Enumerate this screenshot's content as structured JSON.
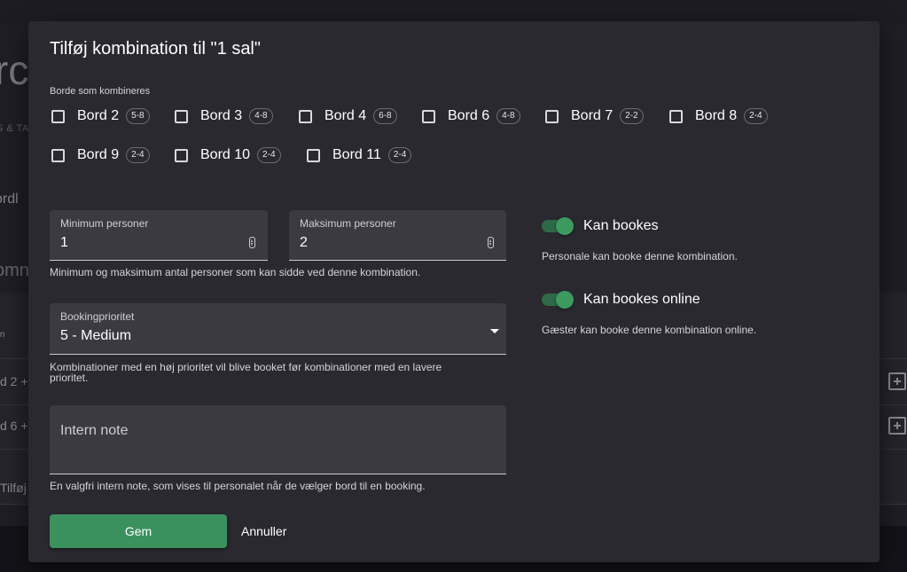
{
  "background": {
    "heading": "rc",
    "subheading": "S & TA",
    "label1": "ordl",
    "label2": "omn",
    "table_header": "n",
    "rows": [
      "d 2 +",
      "d 6 +",
      "Tilføj"
    ]
  },
  "dialog": {
    "title": "Tilføj kombination til \"1 sal\"",
    "tables_label": "Borde som kombineres",
    "tables": [
      {
        "name": "Bord 2",
        "capacity": "5-8",
        "checked": false
      },
      {
        "name": "Bord 3",
        "capacity": "4-8",
        "checked": false
      },
      {
        "name": "Bord 4",
        "capacity": "6-8",
        "checked": false
      },
      {
        "name": "Bord 6",
        "capacity": "4-8",
        "checked": false
      },
      {
        "name": "Bord 7",
        "capacity": "2-2",
        "checked": false
      },
      {
        "name": "Bord 8",
        "capacity": "2-4",
        "checked": false
      },
      {
        "name": "Bord 9",
        "capacity": "2-4",
        "checked": false
      },
      {
        "name": "Bord 10",
        "capacity": "2-4",
        "checked": false
      },
      {
        "name": "Bord 11",
        "capacity": "2-4",
        "checked": false
      }
    ],
    "min_persons": {
      "label": "Minimum personer",
      "value": "1"
    },
    "max_persons": {
      "label": "Maksimum personer",
      "value": "2"
    },
    "persons_helper": "Minimum og maksimum antal personer som kan sidde ved denne kombination.",
    "priority": {
      "label": "Bookingprioritet",
      "value": "5 - Medium"
    },
    "priority_helper_line1": "Kombinationer med en høj prioritet vil blive booket før kombinationer med en lavere",
    "priority_helper_line2": "prioritet.",
    "note": {
      "placeholder": "Intern note",
      "value": ""
    },
    "note_helper": "En valgfri intern note, som vises til personalet når de vælger bord til en booking.",
    "toggle_bookable": {
      "label": "Kan bookes",
      "description": "Personale kan booke denne kombination.",
      "on": true
    },
    "toggle_online": {
      "label": "Kan bookes online",
      "description": "Gæster kan booke denne kombination online.",
      "on": true
    },
    "save_label": "Gem",
    "cancel_label": "Annuller"
  },
  "colors": {
    "accent": "#3b915e",
    "toggle_track": "#2e6a48",
    "dialog_bg": "#2a2930",
    "field_bg": "#3b3a42"
  }
}
